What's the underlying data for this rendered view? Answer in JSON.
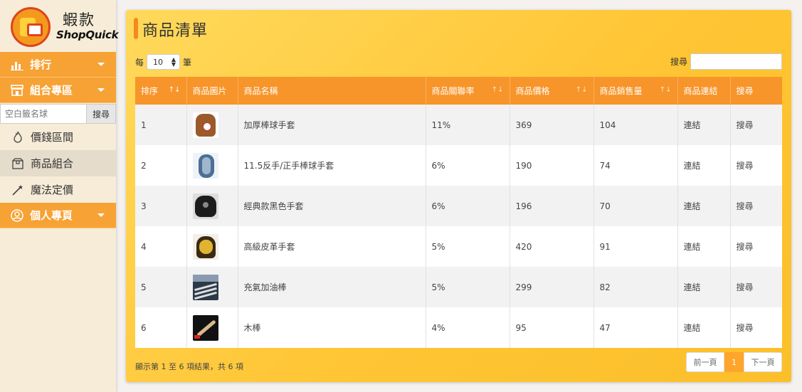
{
  "logo": {
    "cn": "蝦款",
    "en": "ShopQuick"
  },
  "sidebar": {
    "menu1": "排行",
    "menu2": "組合專區",
    "search_placeholder": "空白籤名球",
    "search_button": "搜尋",
    "items": [
      {
        "label": "價錢區間",
        "icon": "flame-icon"
      },
      {
        "label": "商品組合",
        "icon": "package-icon"
      },
      {
        "label": "魔法定價",
        "icon": "magic-wand-icon"
      }
    ],
    "menu3": "個人專頁"
  },
  "panel": {
    "title": "商品清單",
    "length_prefix": "每",
    "length_value": "10",
    "length_suffix": "筆",
    "search_label": "搜尋"
  },
  "table": {
    "headers": [
      "排序",
      "商品圖片",
      "商品名稱",
      "商品關聯率",
      "商品價格",
      "商品銷售量",
      "商品連結",
      "搜尋"
    ],
    "rows": [
      {
        "rank": "1",
        "name": "加厚棒球手套",
        "rate": "11%",
        "price": "369",
        "sales": "104",
        "link": "連結",
        "search": "搜尋",
        "img": "baseball-glove-with-ball"
      },
      {
        "rank": "2",
        "name": "11.5反手/正手棒球手套",
        "rate": "6%",
        "price": "190",
        "sales": "74",
        "link": "連結",
        "search": "搜尋",
        "img": "blue-baseball-glove"
      },
      {
        "rank": "3",
        "name": "經典款黑色手套",
        "rate": "6%",
        "price": "196",
        "sales": "70",
        "link": "連結",
        "search": "搜尋",
        "img": "black-baseball-glove"
      },
      {
        "rank": "4",
        "name": "高級皮革手套",
        "rate": "5%",
        "price": "420",
        "sales": "91",
        "link": "連結",
        "search": "搜尋",
        "img": "yellow-leather-glove"
      },
      {
        "rank": "5",
        "name": "充氣加油棒",
        "rate": "5%",
        "price": "299",
        "sales": "82",
        "link": "連結",
        "search": "搜尋",
        "img": "inflatable-cheer-sticks"
      },
      {
        "rank": "6",
        "name": "木棒",
        "rate": "4%",
        "price": "95",
        "sales": "47",
        "link": "連結",
        "search": "搜尋",
        "img": "wooden-bat"
      }
    ]
  },
  "footer": {
    "info": "顯示第 1 至 6 項結果，共 6 項",
    "prev": "前一頁",
    "current": "1",
    "next": "下一頁"
  },
  "colors": {
    "accent": "#f7952a",
    "panel": "#ffc534",
    "sidebar": "#f7ecd8"
  }
}
